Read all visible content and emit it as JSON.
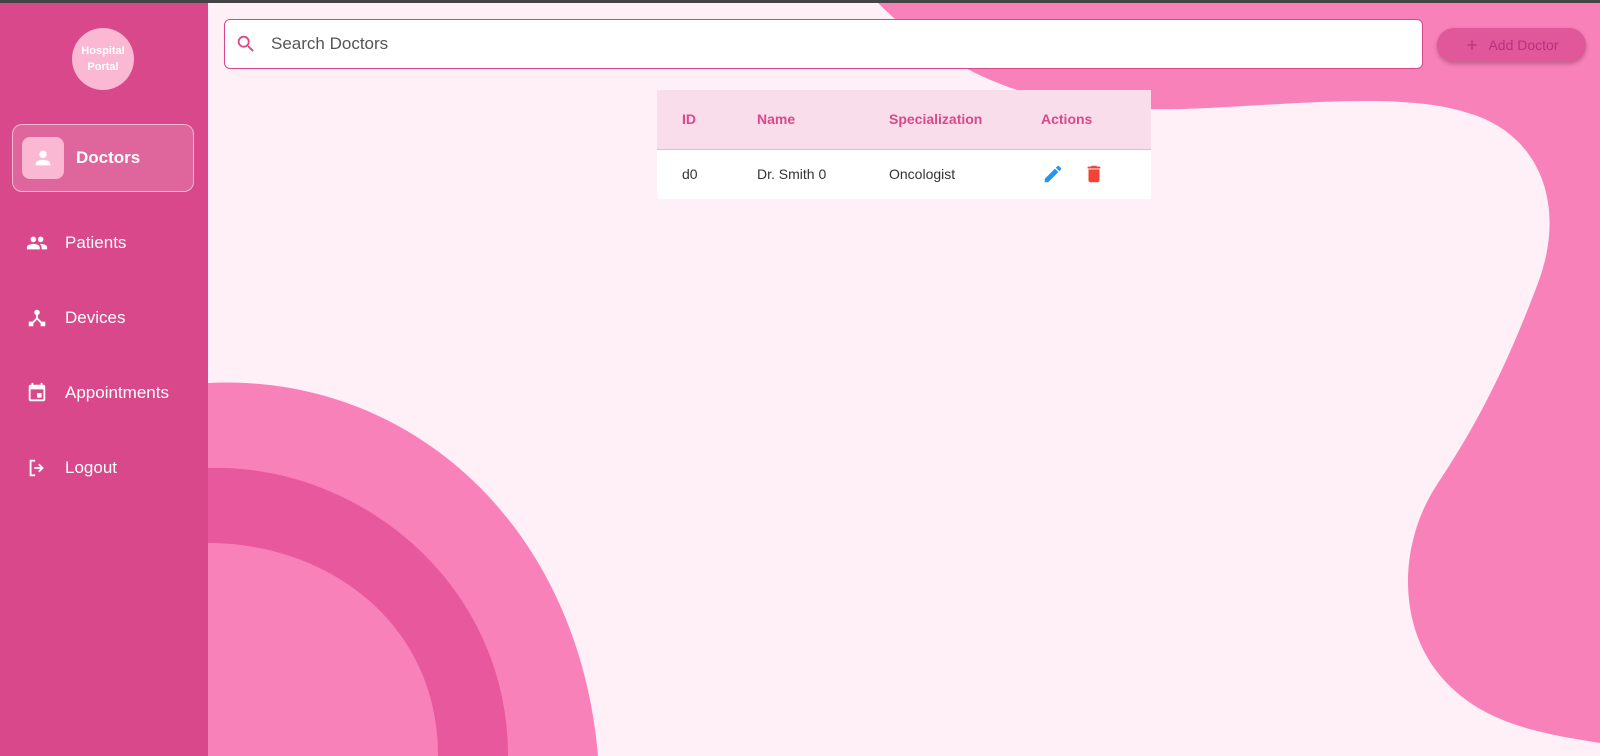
{
  "app": {
    "logo_text": "Hospital Portal"
  },
  "sidebar": {
    "items": [
      {
        "label": "Doctors",
        "icon": "person-icon",
        "active": true
      },
      {
        "label": "Patients",
        "icon": "people-icon",
        "active": false
      },
      {
        "label": "Devices",
        "icon": "device-hub-icon",
        "active": false
      },
      {
        "label": "Appointments",
        "icon": "calendar-icon",
        "active": false
      },
      {
        "label": "Logout",
        "icon": "logout-icon",
        "active": false
      }
    ]
  },
  "search": {
    "placeholder": "Search Doctors",
    "value": ""
  },
  "toolbar": {
    "add_label": "Add Doctor"
  },
  "table": {
    "columns": [
      "ID",
      "Name",
      "Specialization",
      "Actions"
    ],
    "rows": [
      {
        "id": "d0",
        "name": "Dr. Smith 0",
        "specialization": "Oncologist"
      }
    ]
  },
  "colors": {
    "sidebar": "#D9488B",
    "accent": "#E0579A",
    "edit": "#2196F3",
    "delete": "#F44336",
    "background": "#FFF0F7"
  }
}
